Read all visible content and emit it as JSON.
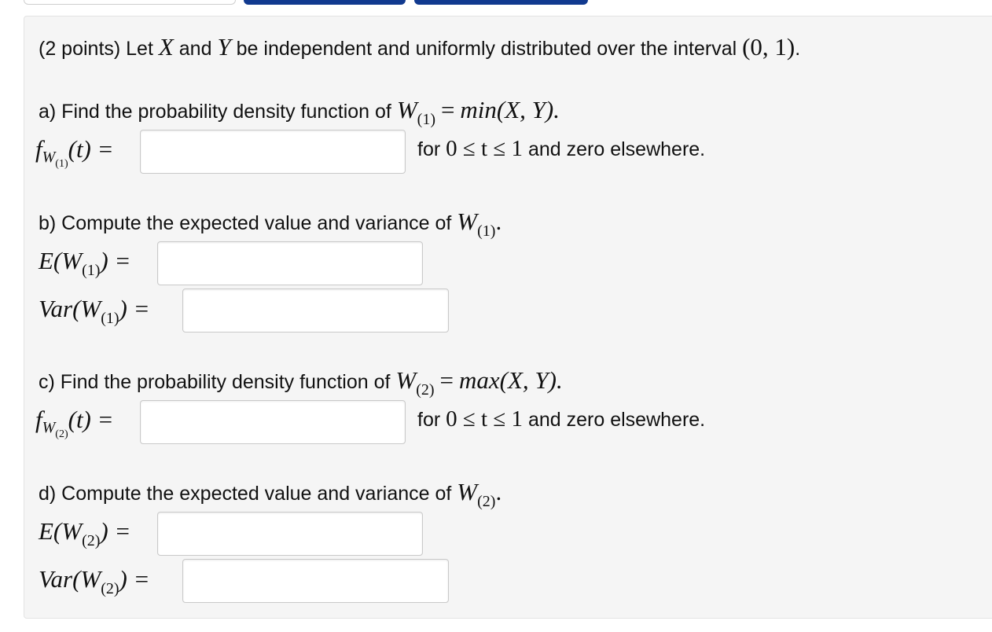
{
  "problem": {
    "intro_prefix": "(2 points) Let",
    "var_x": "X",
    "and": "and",
    "var_y": "Y",
    "intro_suffix": "be independent and uniformly distributed over the interval",
    "interval": "(0, 1)",
    "period": "."
  },
  "parts": {
    "a": {
      "prompt": "a) Find the probability density function of",
      "w": "W",
      "sub": "(1)",
      "eq": "=",
      "func": "min(X, Y).",
      "answer_label_f": "f",
      "answer_label_w": "W",
      "answer_label_sub": "(1)",
      "answer_label_rest": "(t) =",
      "for_text": "for",
      "range_math": "0 ≤ t ≤ 1",
      "tail": "and zero elsewhere."
    },
    "b": {
      "prompt": "b) Compute the expected value and variance of",
      "w": "W",
      "sub": "(1)",
      "dot": ".",
      "e_label_open": "E(W",
      "e_label_sub": "(1)",
      "e_label_close": ") =",
      "var_label_open": "Var(W",
      "var_label_sub": "(1)",
      "var_label_close": ") ="
    },
    "c": {
      "prompt": "c) Find the probability density function of",
      "w": "W",
      "sub": "(2)",
      "eq": "=",
      "func": "max(X, Y).",
      "answer_label_f": "f",
      "answer_label_w": "W",
      "answer_label_sub": "(2)",
      "answer_label_rest": "(t) =",
      "for_text": "for",
      "range_math": "0 ≤ t ≤ 1",
      "tail": "and zero elsewhere."
    },
    "d": {
      "prompt": "d) Compute the expected value and variance of",
      "w": "W",
      "sub": "(2)",
      "dot": ".",
      "e_label_open": "E(W",
      "e_label_sub": "(2)",
      "e_label_close": ") =",
      "var_label_open": "Var(W",
      "var_label_sub": "(2)",
      "var_label_close": ") ="
    }
  },
  "answers": {
    "a_pdf": "",
    "b_expected": "",
    "b_variance": "",
    "c_pdf": "",
    "d_expected": "",
    "d_variance": ""
  },
  "colors": {
    "tab_active": "#113a8f",
    "panel_bg": "#f5f5f5"
  }
}
